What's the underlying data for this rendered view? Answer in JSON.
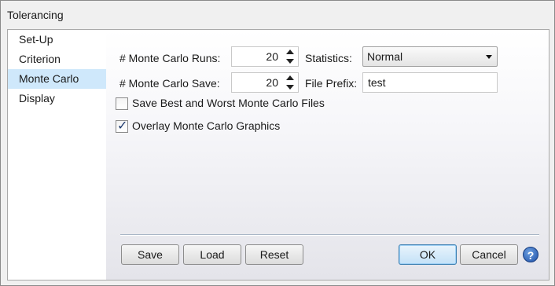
{
  "window": {
    "title": "Tolerancing"
  },
  "sidebar": {
    "items": [
      {
        "label": "Set-Up"
      },
      {
        "label": "Criterion"
      },
      {
        "label": "Monte Carlo",
        "selected": true
      },
      {
        "label": "Display"
      }
    ]
  },
  "form": {
    "runs_label": "# Monte Carlo Runs:",
    "runs_value": "20",
    "save_label": "# Monte Carlo Save:",
    "save_value": "20",
    "statistics_label": "Statistics:",
    "statistics_value": "Normal",
    "file_prefix_label": "File Prefix:",
    "file_prefix_value": "test",
    "save_best_worst": {
      "label": "Save Best and Worst Monte Carlo Files",
      "checked": false
    },
    "overlay_graphics": {
      "label": "Overlay Monte Carlo Graphics",
      "checked": true
    }
  },
  "buttons": {
    "save": "Save",
    "load": "Load",
    "reset": "Reset",
    "ok": "OK",
    "cancel": "Cancel",
    "help": "?"
  },
  "colors": {
    "selection": "#cfe8fb",
    "help_icon": "#1c4fa8",
    "default_button_border": "#3c7fb1"
  }
}
